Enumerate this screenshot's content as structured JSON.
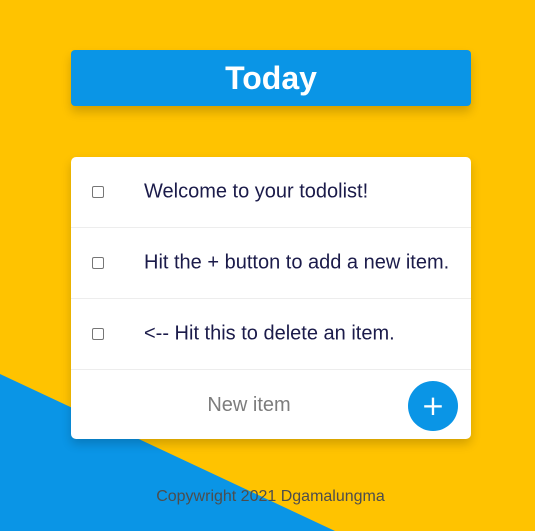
{
  "colors": {
    "background_yellow": "#FFC300",
    "background_blue": "#0A95E6",
    "title_bar": "#0A95E6",
    "card": "#FFFFFF",
    "item_text": "#1B1B4A",
    "footer_text": "#4D4D4D"
  },
  "header": {
    "title": "Today"
  },
  "todos": [
    {
      "label": "Welcome to your todolist!",
      "checked": false
    },
    {
      "label": "Hit the + button to add a new item.",
      "checked": false
    },
    {
      "label": "<-- Hit this to delete an item.",
      "checked": false
    }
  ],
  "new_item": {
    "placeholder": "New item",
    "value": "",
    "add_label": "+"
  },
  "footer": {
    "text": "Copywright 2021 Dgamalungma"
  },
  "icons": {
    "add": "plus-icon"
  }
}
